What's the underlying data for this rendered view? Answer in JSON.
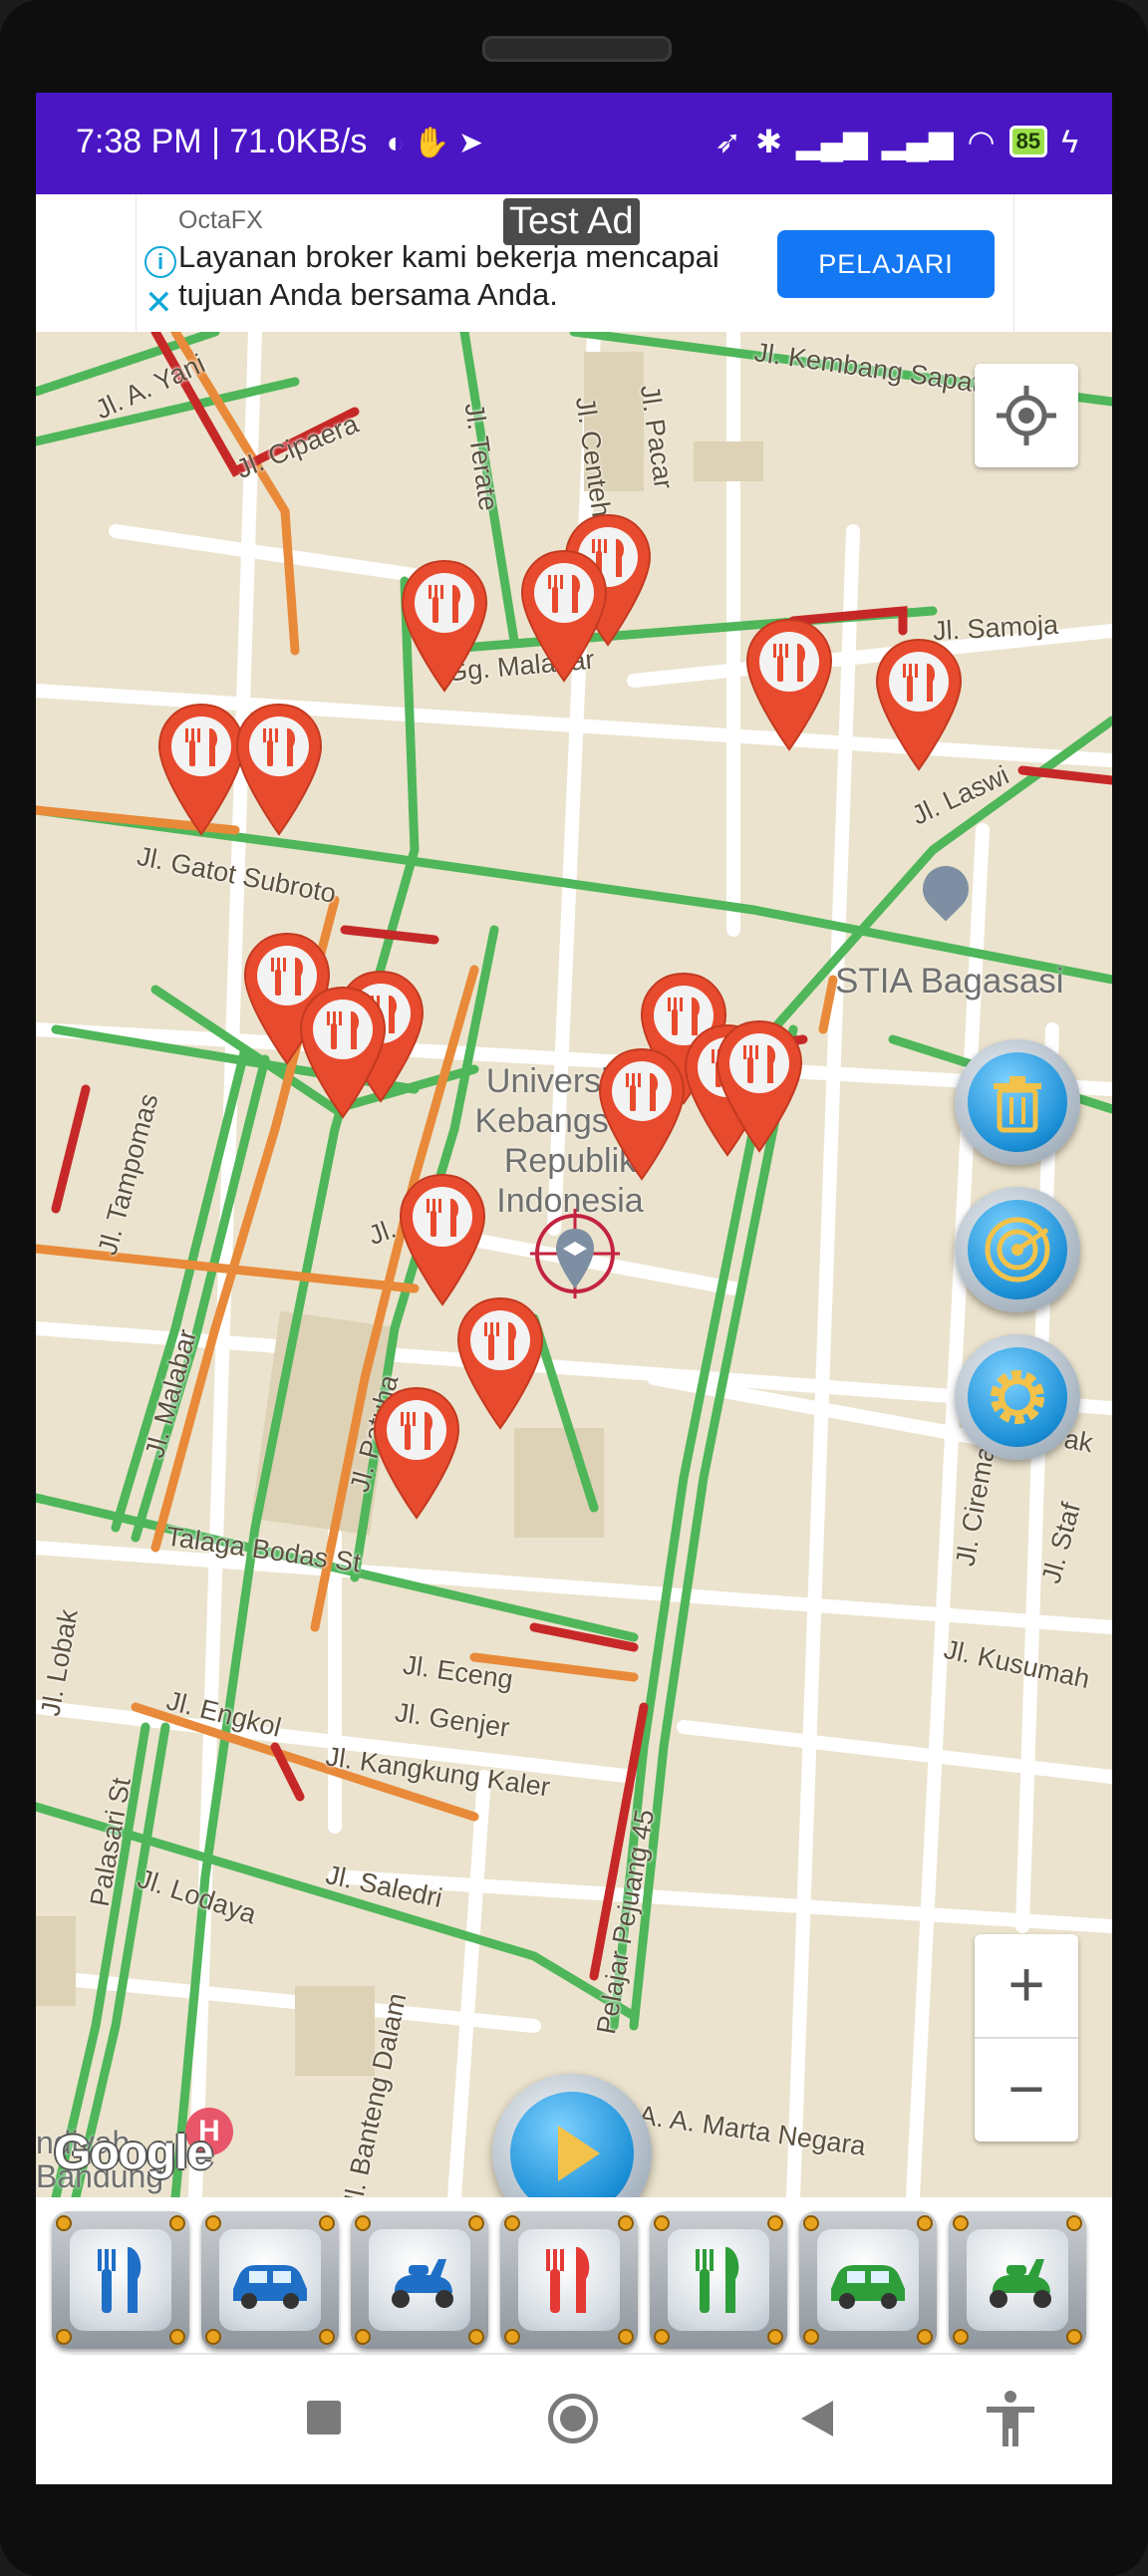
{
  "status_bar": {
    "time_info": "7:38 PM | 71.0KB/s",
    "battery": "85"
  },
  "ad": {
    "badge": "Test Ad",
    "advertiser": "OctaFX",
    "text": "Layanan broker kami bekerja mencapai tujuan Anda bersama Anda.",
    "cta": "PELAJARI"
  },
  "map": {
    "streets": {
      "a_yani": "Jl. A. Yani",
      "cipaera": "Jl. Cipaera",
      "terate": "Jl. Terate",
      "centeh": "Jl. Centeh",
      "pacar": "Jl. Pacar",
      "kembang_sapatu": "Jl. Kembang Sapatu",
      "samoja": "Jl. Samoja",
      "malabar_gg": "Gg. Malabar",
      "laswi": "Jl. Laswi",
      "gatot_subroto": "Jl. Gatot Subroto",
      "tampomas": "Jl. Tampomas",
      "malabar": "Jl. Malabar",
      "patuha": "Jl. Patuha",
      "talaga_bodas": "Talaga Bodas St",
      "lobak": "Jl. Lobak",
      "engkol": "Jl. Engkol",
      "eceng": "Jl. Eceng",
      "genjer": "Jl. Genjer",
      "kangkung_kaler": "Jl. Kangkung Kaler",
      "saledri": "Jl. Saledri",
      "lodaya": "Jl. Lodaya",
      "palasari": "Palasari St",
      "pelajar_pejuang": "Pelajar Pejuang 45",
      "banteng_dalam": "Jl. Banteng Dalam",
      "marta_negara": "A. A. Marta Negara",
      "ciremai": "Jl. Ciremai",
      "staf": "Jl. Staf",
      "kusumah": "Jl. Kusumah",
      "ak": "ak",
      "lingk": "Jl. Lingk"
    },
    "pois": {
      "university": "Universitas Kebangsaan Republik Indonesia",
      "stia": "STIA Bagasasi",
      "bottom_left": "ndiyah Bandung"
    },
    "google_logo": "Google",
    "zoom_in": "+",
    "zoom_out": "−"
  },
  "colors": {
    "status_bar": "#4a16c4",
    "marker": "#e84a2e",
    "traffic_green": "#4fb65a",
    "traffic_orange": "#e88a3a",
    "traffic_red": "#c62828",
    "map_background": "#ebe3cd"
  },
  "toolbar": {
    "items": [
      {
        "name": "restaurant-blue",
        "icon": "fork-knife-icon",
        "color": "#1f6fc7"
      },
      {
        "name": "car-blue",
        "icon": "car-icon",
        "color": "#1f6fc7"
      },
      {
        "name": "scooter-blue",
        "icon": "scooter-icon",
        "color": "#1f6fc7"
      },
      {
        "name": "restaurant-red",
        "icon": "fork-knife-icon",
        "color": "#e53935"
      },
      {
        "name": "restaurant-green",
        "icon": "fork-knife-icon",
        "color": "#2e9e3a"
      },
      {
        "name": "car-green",
        "icon": "car-icon",
        "color": "#2e9e3a"
      },
      {
        "name": "scooter-green",
        "icon": "scooter-icon",
        "color": "#2e9e3a"
      }
    ]
  }
}
